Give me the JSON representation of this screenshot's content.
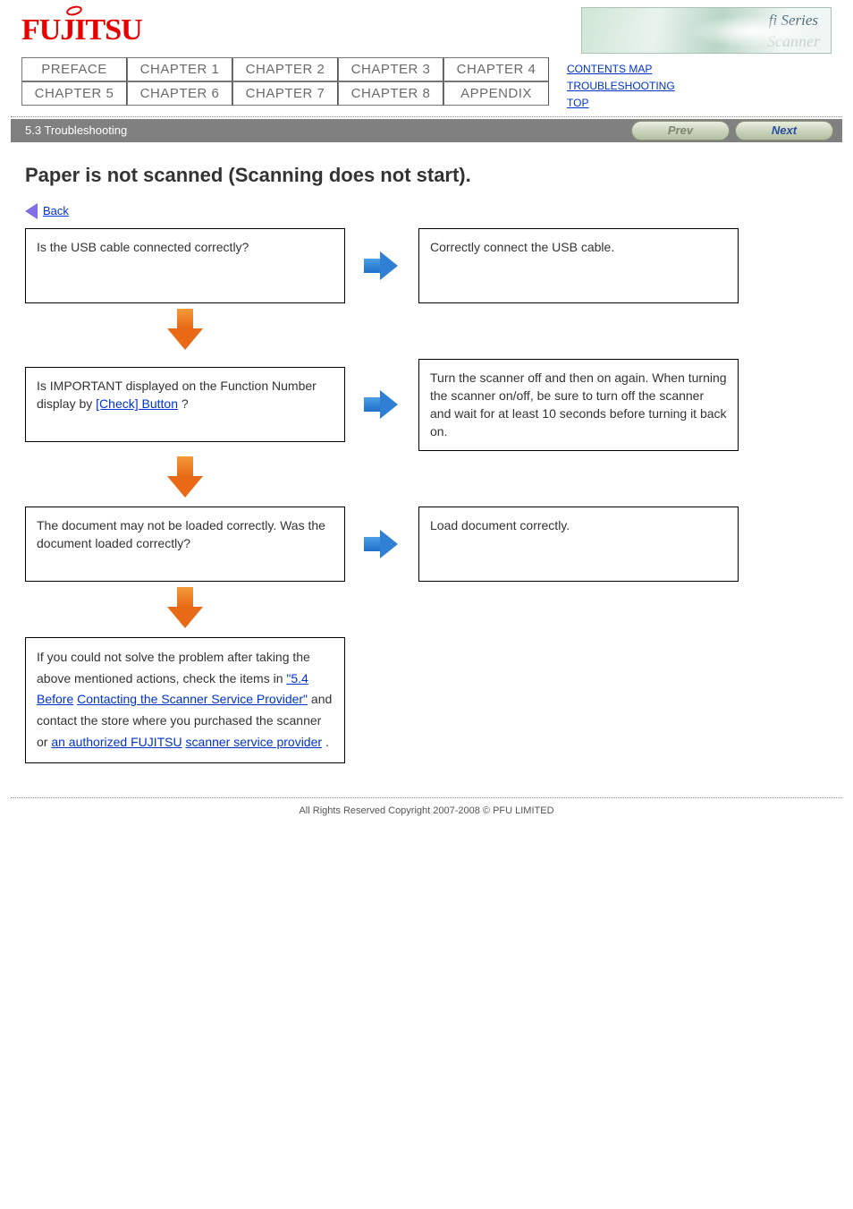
{
  "brand": "FUJITSU",
  "product_series": "fi Series",
  "product_sub": "Scanner",
  "tabs": [
    "PREFACE",
    "CHAPTER 1",
    "CHAPTER 2",
    "CHAPTER 3",
    "CHAPTER 4",
    "CHAPTER 5",
    "CHAPTER 6",
    "CHAPTER 7",
    "CHAPTER 8",
    "APPENDIX"
  ],
  "sidebar": {
    "l1": "CONTENTS MAP",
    "l2": "TROUBLESHOOTING",
    "l3": "TOP"
  },
  "bar_label": "5.3 Troubleshooting",
  "bar": {
    "prev": "Prev",
    "next": "Next"
  },
  "title": "Paper is not scanned (Scanning does not start).",
  "back_label": "Back",
  "row1": {
    "q": "Is the USB cable connected correctly?",
    "a": "Correctly connect the USB cable."
  },
  "row2": {
    "q1": "Is IMPORTANT displayed on the Function Number display by ",
    "qlink": "[Check] Button",
    "q2": "?",
    "a": "Turn the scanner off and then on again. When turning the scanner on/off, be sure to turn off the scanner and wait for at least 10 seconds before turning it back on."
  },
  "row3": {
    "q": "The document may not be loaded correctly. Was the document loaded correctly?",
    "a": "Load document correctly."
  },
  "final": {
    "p1_pre": "If you could not solve the problem after taking the above mentioned actions, check the items in ",
    "l1": "\"5.4 Before",
    "l2": "Contacting the Scanner Service Provider\"",
    "p1_post": " and contact the store where you purchased the scanner or ",
    "l3": "an authorized FUJITSU",
    "l4": "scanner service provider",
    "period": "."
  },
  "copyright": "All Rights Reserved Copyright 2007-2008 © PFU LIMITED"
}
